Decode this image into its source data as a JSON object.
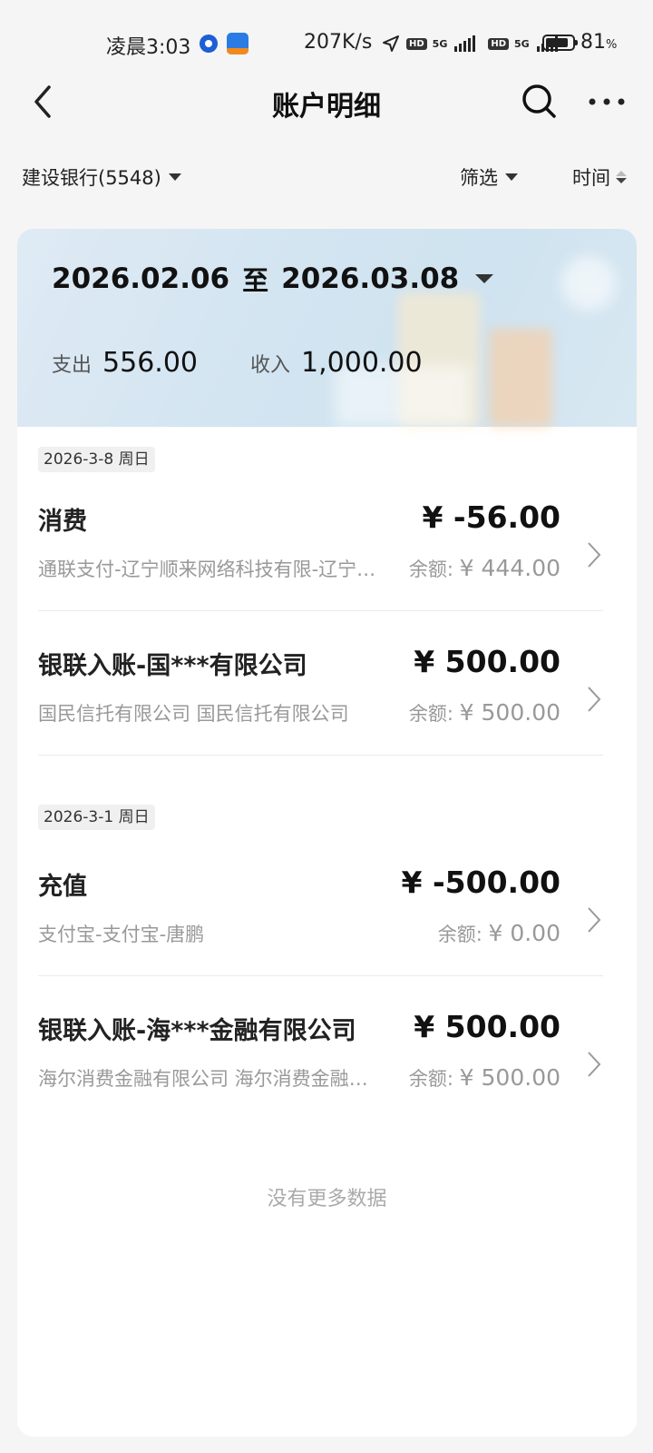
{
  "status_bar": {
    "time": "凌晨3:03",
    "net_speed": "207K/s",
    "hd1": "HD",
    "net1": "5G",
    "hd2": "HD",
    "net2": "5G",
    "battery_pct": "81",
    "battery_unit": "%"
  },
  "nav": {
    "title": "账户明细",
    "icons": [
      "chevron-left-icon",
      "search-icon",
      "more-icon"
    ]
  },
  "filters": {
    "account": "建设银行(5548)",
    "screen_label": "筛选",
    "time_label": "时间"
  },
  "summary": {
    "date_from": "2026.02.06",
    "to": "至",
    "date_to": "2026.03.08",
    "expense_label": "支出",
    "expense_value": "556.00",
    "income_label": "收入",
    "income_value": "1,000.00"
  },
  "groups": [
    {
      "date": "2026-3-8 周日",
      "transactions": [
        {
          "title": "消费",
          "amount": "¥  -56.00",
          "desc": "通联支付-辽宁顺来网络科技有限-辽宁顺来网络科技有限公司",
          "balance_label": "余额:",
          "balance": "¥  444.00"
        },
        {
          "title": "银联入账-国***有限公司",
          "amount": "¥  500.00",
          "desc": "国民信托有限公司 国民信托有限公司",
          "balance_label": "余额:",
          "balance": "¥  500.00"
        }
      ]
    },
    {
      "date": "2026-3-1 周日",
      "transactions": [
        {
          "title": "充值",
          "amount": "¥  -500.00",
          "desc": "支付宝-支付宝-唐鹏",
          "balance_label": "余额:",
          "balance": "¥  0.00"
        },
        {
          "title": "银联入账-海***金融有限公司",
          "amount": "¥  500.00",
          "desc": "海尔消费金融有限公司 海尔消费金融有限公司",
          "balance_label": "余额:",
          "balance": "¥  500.00"
        }
      ]
    }
  ],
  "footer": {
    "no_more": "没有更多数据"
  }
}
